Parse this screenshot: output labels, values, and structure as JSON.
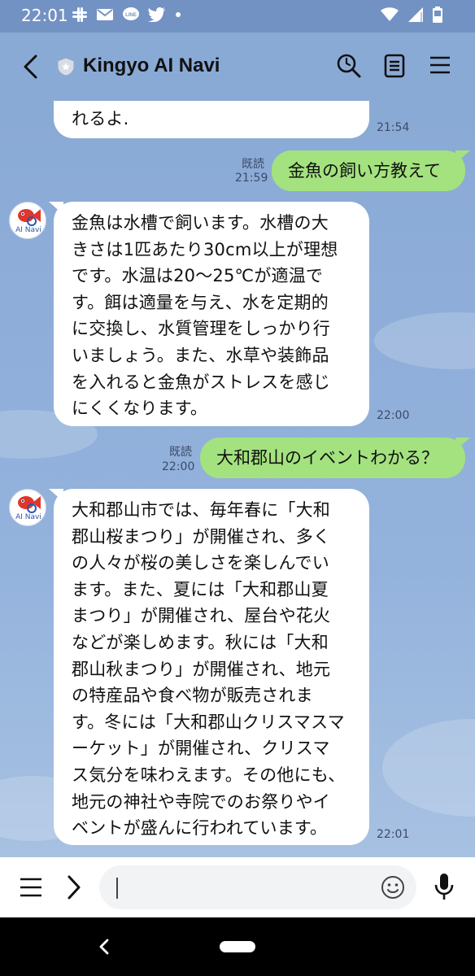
{
  "status_bar": {
    "time": "22:01",
    "left_icons": [
      "slack-icon",
      "mail-icon",
      "line-icon",
      "twitter-icon",
      "dot-icon"
    ],
    "right_icons": [
      "wifi-icon",
      "signal-icon",
      "battery-icon"
    ]
  },
  "header": {
    "title": "Kingyo AI Navi",
    "icons": [
      "back-icon",
      "shield-icon",
      "search-icon",
      "notes-icon",
      "menu-icon"
    ]
  },
  "messages": [
    {
      "direction": "in",
      "lines": [
        "れるよ."
      ],
      "time": "21:54"
    },
    {
      "direction": "out",
      "text": "金魚の飼い方教えて",
      "read": "既読",
      "time": "21:59"
    },
    {
      "direction": "in",
      "avatar_label": "AI Navi",
      "lines": [
        "金魚は水槽で飼います。水槽の大",
        "きさは1匹あたり30cm以上が理想",
        "です。水温は20〜25℃が適温で",
        "す。餌は適量を与え、水を定期的",
        "に交換し、水質管理をしっかり行",
        "いましょう。また、水草や装飾品",
        "を入れると金魚がストレスを感じ",
        "にくくなります。"
      ],
      "time": "22:00"
    },
    {
      "direction": "out",
      "text": "大和郡山のイベントわかる？",
      "read": "既読",
      "time": "22:00"
    },
    {
      "direction": "in",
      "avatar_label": "AI Navi",
      "lines": [
        "大和郡山市では、毎年春に「大和",
        "郡山桜まつり」が開催され、多く",
        "の人々が桜の美しさを楽しんでい",
        "ます。また、夏には「大和郡山夏",
        "まつり」が開催され、屋台や花火",
        "などが楽しめます。秋には「大和",
        "郡山秋まつり」が開催され、地元",
        "の特産品や食べ物が販売されま",
        "す。冬には「大和郡山クリスマスマ",
        "ーケット」が開催され、クリスマ",
        "ス気分を味わえます。その他にも、",
        "地元の神社や寺院でのお祭りやイ",
        "ベントが盛んに行われています。"
      ],
      "time": "22:01"
    }
  ],
  "input_bar": {
    "value": "",
    "icons": [
      "menu-icon",
      "chevron-right-icon",
      "emoji-icon",
      "microphone-icon"
    ]
  },
  "colors": {
    "chat_background": "#8aaad6",
    "outgoing_bubble": "#a3e27f",
    "incoming_bubble": "#ffffff",
    "status_bar": "#7392c4"
  }
}
